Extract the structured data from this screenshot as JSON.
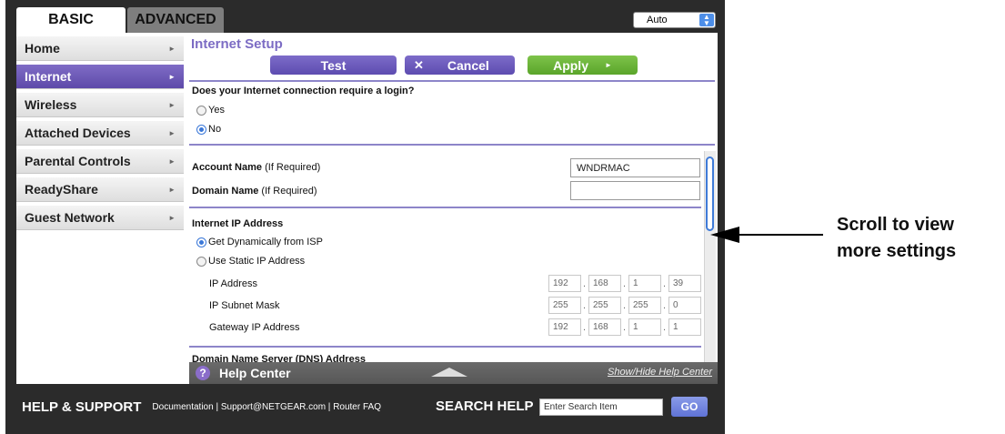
{
  "tabs": {
    "basic": "BASIC",
    "advanced": "ADVANCED"
  },
  "language_select": {
    "value": "Auto"
  },
  "sidebar": {
    "items": [
      {
        "label": "Home"
      },
      {
        "label": "Internet"
      },
      {
        "label": "Wireless"
      },
      {
        "label": "Attached Devices"
      },
      {
        "label": "Parental Controls"
      },
      {
        "label": "ReadyShare"
      },
      {
        "label": "Guest Network"
      }
    ]
  },
  "content": {
    "title": "Internet Setup",
    "buttons": {
      "test": "Test",
      "cancel": "Cancel",
      "apply": "Apply"
    },
    "login_question": "Does your Internet connection require a login?",
    "login_options": {
      "yes": "Yes",
      "no": "No"
    },
    "account_name_label": "Account Name",
    "account_name_hint": "(If Required)",
    "account_name_value": "WNDRMAC",
    "domain_name_label": "Domain Name",
    "domain_name_hint": "(If Required)",
    "domain_name_value": "",
    "ip_section_title": "Internet IP Address",
    "ip_options": {
      "dynamic": "Get Dynamically from ISP",
      "static": "Use Static IP Address"
    },
    "ip_address_label": "IP Address",
    "ip_address": [
      "192",
      "168",
      "1",
      "39"
    ],
    "subnet_label": "IP Subnet Mask",
    "subnet": [
      "255",
      "255",
      "255",
      "0"
    ],
    "gateway_label": "Gateway IP Address",
    "gateway": [
      "192",
      "168",
      "1",
      "1"
    ],
    "dns_section_title": "Domain Name Server (DNS) Address"
  },
  "help_center": {
    "title": "Help Center",
    "toggle": "Show/Hide Help Center"
  },
  "footer": {
    "title": "HELP & SUPPORT",
    "links": [
      "Documentation",
      "Support@NETGEAR.com",
      "Router FAQ"
    ],
    "search_label": "SEARCH HELP",
    "search_placeholder": "Enter Search Item",
    "go": "GO"
  },
  "annotation": {
    "line1": "Scroll to view",
    "line2": "more settings"
  },
  "colors": {
    "accent": "#6a59b8",
    "apply": "#6bb43a",
    "frame": "#2b2b2b",
    "scroll": "#3f7bd8"
  }
}
